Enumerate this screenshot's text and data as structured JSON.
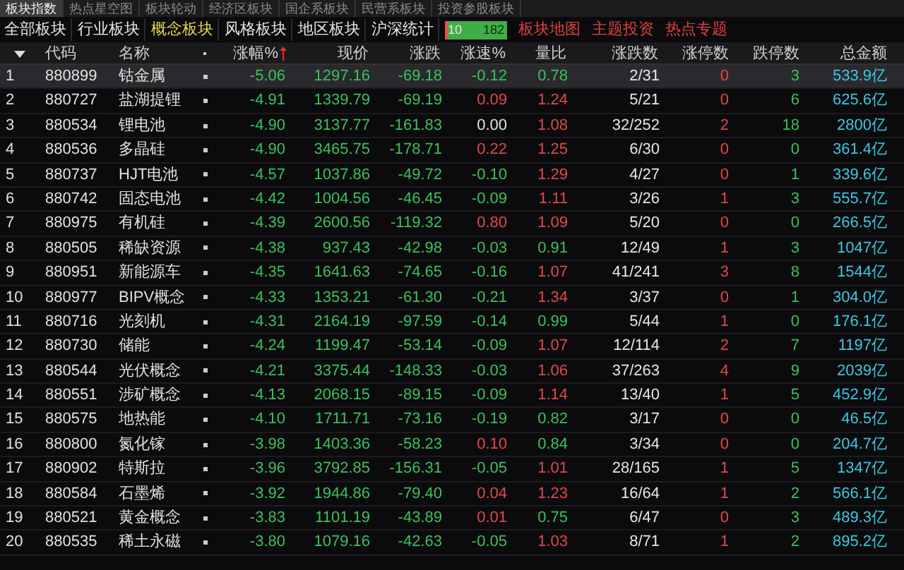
{
  "top_tabs": [
    {
      "label": "板块指数",
      "selected": true
    },
    {
      "label": "热点星空图",
      "selected": false
    },
    {
      "label": "板块轮动",
      "selected": false
    },
    {
      "label": "经济区板块",
      "selected": false
    },
    {
      "label": "国企系板块",
      "selected": false
    },
    {
      "label": "民营系板块",
      "selected": false
    },
    {
      "label": "投资参股板块",
      "selected": false
    }
  ],
  "category_tabs": [
    {
      "label": "全部板块",
      "selected": false
    },
    {
      "label": "行业板块",
      "selected": false
    },
    {
      "label": "概念板块",
      "selected": true
    },
    {
      "label": "风格板块",
      "selected": false
    },
    {
      "label": "地区板块",
      "selected": false
    },
    {
      "label": "沪深统计",
      "selected": false
    }
  ],
  "breadth": {
    "up": "10",
    "down": "182",
    "level": 0.05
  },
  "links": [
    "板块地图",
    "主题投资",
    "热点专题"
  ],
  "columns": [
    "代码",
    "名称",
    "涨幅%",
    "现价",
    "涨跌",
    "涨速%",
    "量比",
    "涨跌数",
    "涨停数",
    "跌停数",
    "总金额"
  ],
  "rows": [
    {
      "no": "1",
      "code": "880899",
      "name": "钴金属",
      "change_pct": "-5.06",
      "price": "1297.16",
      "change": "-69.18",
      "speed": "-0.12",
      "vol_ratio": "0.78",
      "up_down": "2/31",
      "limit_up": "0",
      "limit_down": "3",
      "turnover": "533.9亿",
      "selected": true
    },
    {
      "no": "2",
      "code": "880727",
      "name": "盐湖提锂",
      "change_pct": "-4.91",
      "price": "1339.79",
      "change": "-69.19",
      "speed": "0.09",
      "vol_ratio": "1.24",
      "up_down": "5/21",
      "limit_up": "0",
      "limit_down": "6",
      "turnover": "625.6亿",
      "selected": false
    },
    {
      "no": "3",
      "code": "880534",
      "name": "锂电池",
      "change_pct": "-4.90",
      "price": "3137.77",
      "change": "-161.83",
      "speed": "0.00",
      "vol_ratio": "1.08",
      "up_down": "32/252",
      "limit_up": "2",
      "limit_down": "18",
      "turnover": "2800亿",
      "selected": false
    },
    {
      "no": "4",
      "code": "880536",
      "name": "多晶硅",
      "change_pct": "-4.90",
      "price": "3465.75",
      "change": "-178.71",
      "speed": "0.22",
      "vol_ratio": "1.25",
      "up_down": "6/30",
      "limit_up": "0",
      "limit_down": "0",
      "turnover": "361.4亿",
      "selected": false
    },
    {
      "no": "5",
      "code": "880737",
      "name": "HJT电池",
      "change_pct": "-4.57",
      "price": "1037.86",
      "change": "-49.72",
      "speed": "-0.10",
      "vol_ratio": "1.29",
      "up_down": "4/27",
      "limit_up": "0",
      "limit_down": "1",
      "turnover": "339.6亿",
      "selected": false
    },
    {
      "no": "6",
      "code": "880742",
      "name": "固态电池",
      "change_pct": "-4.42",
      "price": "1004.56",
      "change": "-46.45",
      "speed": "-0.09",
      "vol_ratio": "1.11",
      "up_down": "3/26",
      "limit_up": "1",
      "limit_down": "3",
      "turnover": "555.7亿",
      "selected": false
    },
    {
      "no": "7",
      "code": "880975",
      "name": "有机硅",
      "change_pct": "-4.39",
      "price": "2600.56",
      "change": "-119.32",
      "speed": "0.80",
      "vol_ratio": "1.09",
      "up_down": "5/20",
      "limit_up": "0",
      "limit_down": "0",
      "turnover": "266.5亿",
      "selected": false
    },
    {
      "no": "8",
      "code": "880505",
      "name": "稀缺资源",
      "change_pct": "-4.38",
      "price": "937.43",
      "change": "-42.98",
      "speed": "-0.03",
      "vol_ratio": "0.91",
      "up_down": "12/49",
      "limit_up": "1",
      "limit_down": "3",
      "turnover": "1047亿",
      "selected": false
    },
    {
      "no": "9",
      "code": "880951",
      "name": "新能源车",
      "change_pct": "-4.35",
      "price": "1641.63",
      "change": "-74.65",
      "speed": "-0.16",
      "vol_ratio": "1.07",
      "up_down": "41/241",
      "limit_up": "3",
      "limit_down": "8",
      "turnover": "1544亿",
      "selected": false
    },
    {
      "no": "10",
      "code": "880977",
      "name": "BIPV概念",
      "change_pct": "-4.33",
      "price": "1353.21",
      "change": "-61.30",
      "speed": "-0.21",
      "vol_ratio": "1.34",
      "up_down": "3/37",
      "limit_up": "0",
      "limit_down": "1",
      "turnover": "304.0亿",
      "selected": false
    },
    {
      "no": "11",
      "code": "880716",
      "name": "光刻机",
      "change_pct": "-4.31",
      "price": "2164.19",
      "change": "-97.59",
      "speed": "-0.14",
      "vol_ratio": "0.99",
      "up_down": "5/44",
      "limit_up": "1",
      "limit_down": "0",
      "turnover": "176.1亿",
      "selected": false
    },
    {
      "no": "12",
      "code": "880730",
      "name": "储能",
      "change_pct": "-4.24",
      "price": "1199.47",
      "change": "-53.14",
      "speed": "-0.09",
      "vol_ratio": "1.07",
      "up_down": "12/114",
      "limit_up": "2",
      "limit_down": "7",
      "turnover": "1197亿",
      "selected": false
    },
    {
      "no": "13",
      "code": "880544",
      "name": "光伏概念",
      "change_pct": "-4.21",
      "price": "3375.44",
      "change": "-148.33",
      "speed": "-0.03",
      "vol_ratio": "1.06",
      "up_down": "37/263",
      "limit_up": "4",
      "limit_down": "9",
      "turnover": "2039亿",
      "selected": false
    },
    {
      "no": "14",
      "code": "880551",
      "name": "涉矿概念",
      "change_pct": "-4.13",
      "price": "2068.15",
      "change": "-89.15",
      "speed": "-0.09",
      "vol_ratio": "1.14",
      "up_down": "13/40",
      "limit_up": "1",
      "limit_down": "5",
      "turnover": "452.9亿",
      "selected": false
    },
    {
      "no": "15",
      "code": "880575",
      "name": "地热能",
      "change_pct": "-4.10",
      "price": "1711.71",
      "change": "-73.16",
      "speed": "-0.19",
      "vol_ratio": "0.82",
      "up_down": "3/17",
      "limit_up": "0",
      "limit_down": "0",
      "turnover": "46.5亿",
      "selected": false
    },
    {
      "no": "16",
      "code": "880800",
      "name": "氮化镓",
      "change_pct": "-3.98",
      "price": "1403.36",
      "change": "-58.23",
      "speed": "0.10",
      "vol_ratio": "0.84",
      "up_down": "3/34",
      "limit_up": "0",
      "limit_down": "0",
      "turnover": "204.7亿",
      "selected": false
    },
    {
      "no": "17",
      "code": "880902",
      "name": "特斯拉",
      "change_pct": "-3.96",
      "price": "3792.85",
      "change": "-156.31",
      "speed": "-0.05",
      "vol_ratio": "1.01",
      "up_down": "28/165",
      "limit_up": "1",
      "limit_down": "5",
      "turnover": "1347亿",
      "selected": false
    },
    {
      "no": "18",
      "code": "880584",
      "name": "石墨烯",
      "change_pct": "-3.92",
      "price": "1944.86",
      "change": "-79.40",
      "speed": "0.04",
      "vol_ratio": "1.23",
      "up_down": "16/64",
      "limit_up": "1",
      "limit_down": "2",
      "turnover": "566.1亿",
      "selected": false
    },
    {
      "no": "19",
      "code": "880521",
      "name": "黄金概念",
      "change_pct": "-3.83",
      "price": "1101.19",
      "change": "-43.89",
      "speed": "0.01",
      "vol_ratio": "0.75",
      "up_down": "6/47",
      "limit_up": "0",
      "limit_down": "3",
      "turnover": "489.3亿",
      "selected": false
    },
    {
      "no": "20",
      "code": "880535",
      "name": "稀土永磁",
      "change_pct": "-3.80",
      "price": "1079.16",
      "change": "-42.63",
      "speed": "-0.05",
      "vol_ratio": "1.03",
      "up_down": "8/71",
      "limit_up": "1",
      "limit_down": "2",
      "turnover": "895.2亿",
      "selected": false
    }
  ]
}
